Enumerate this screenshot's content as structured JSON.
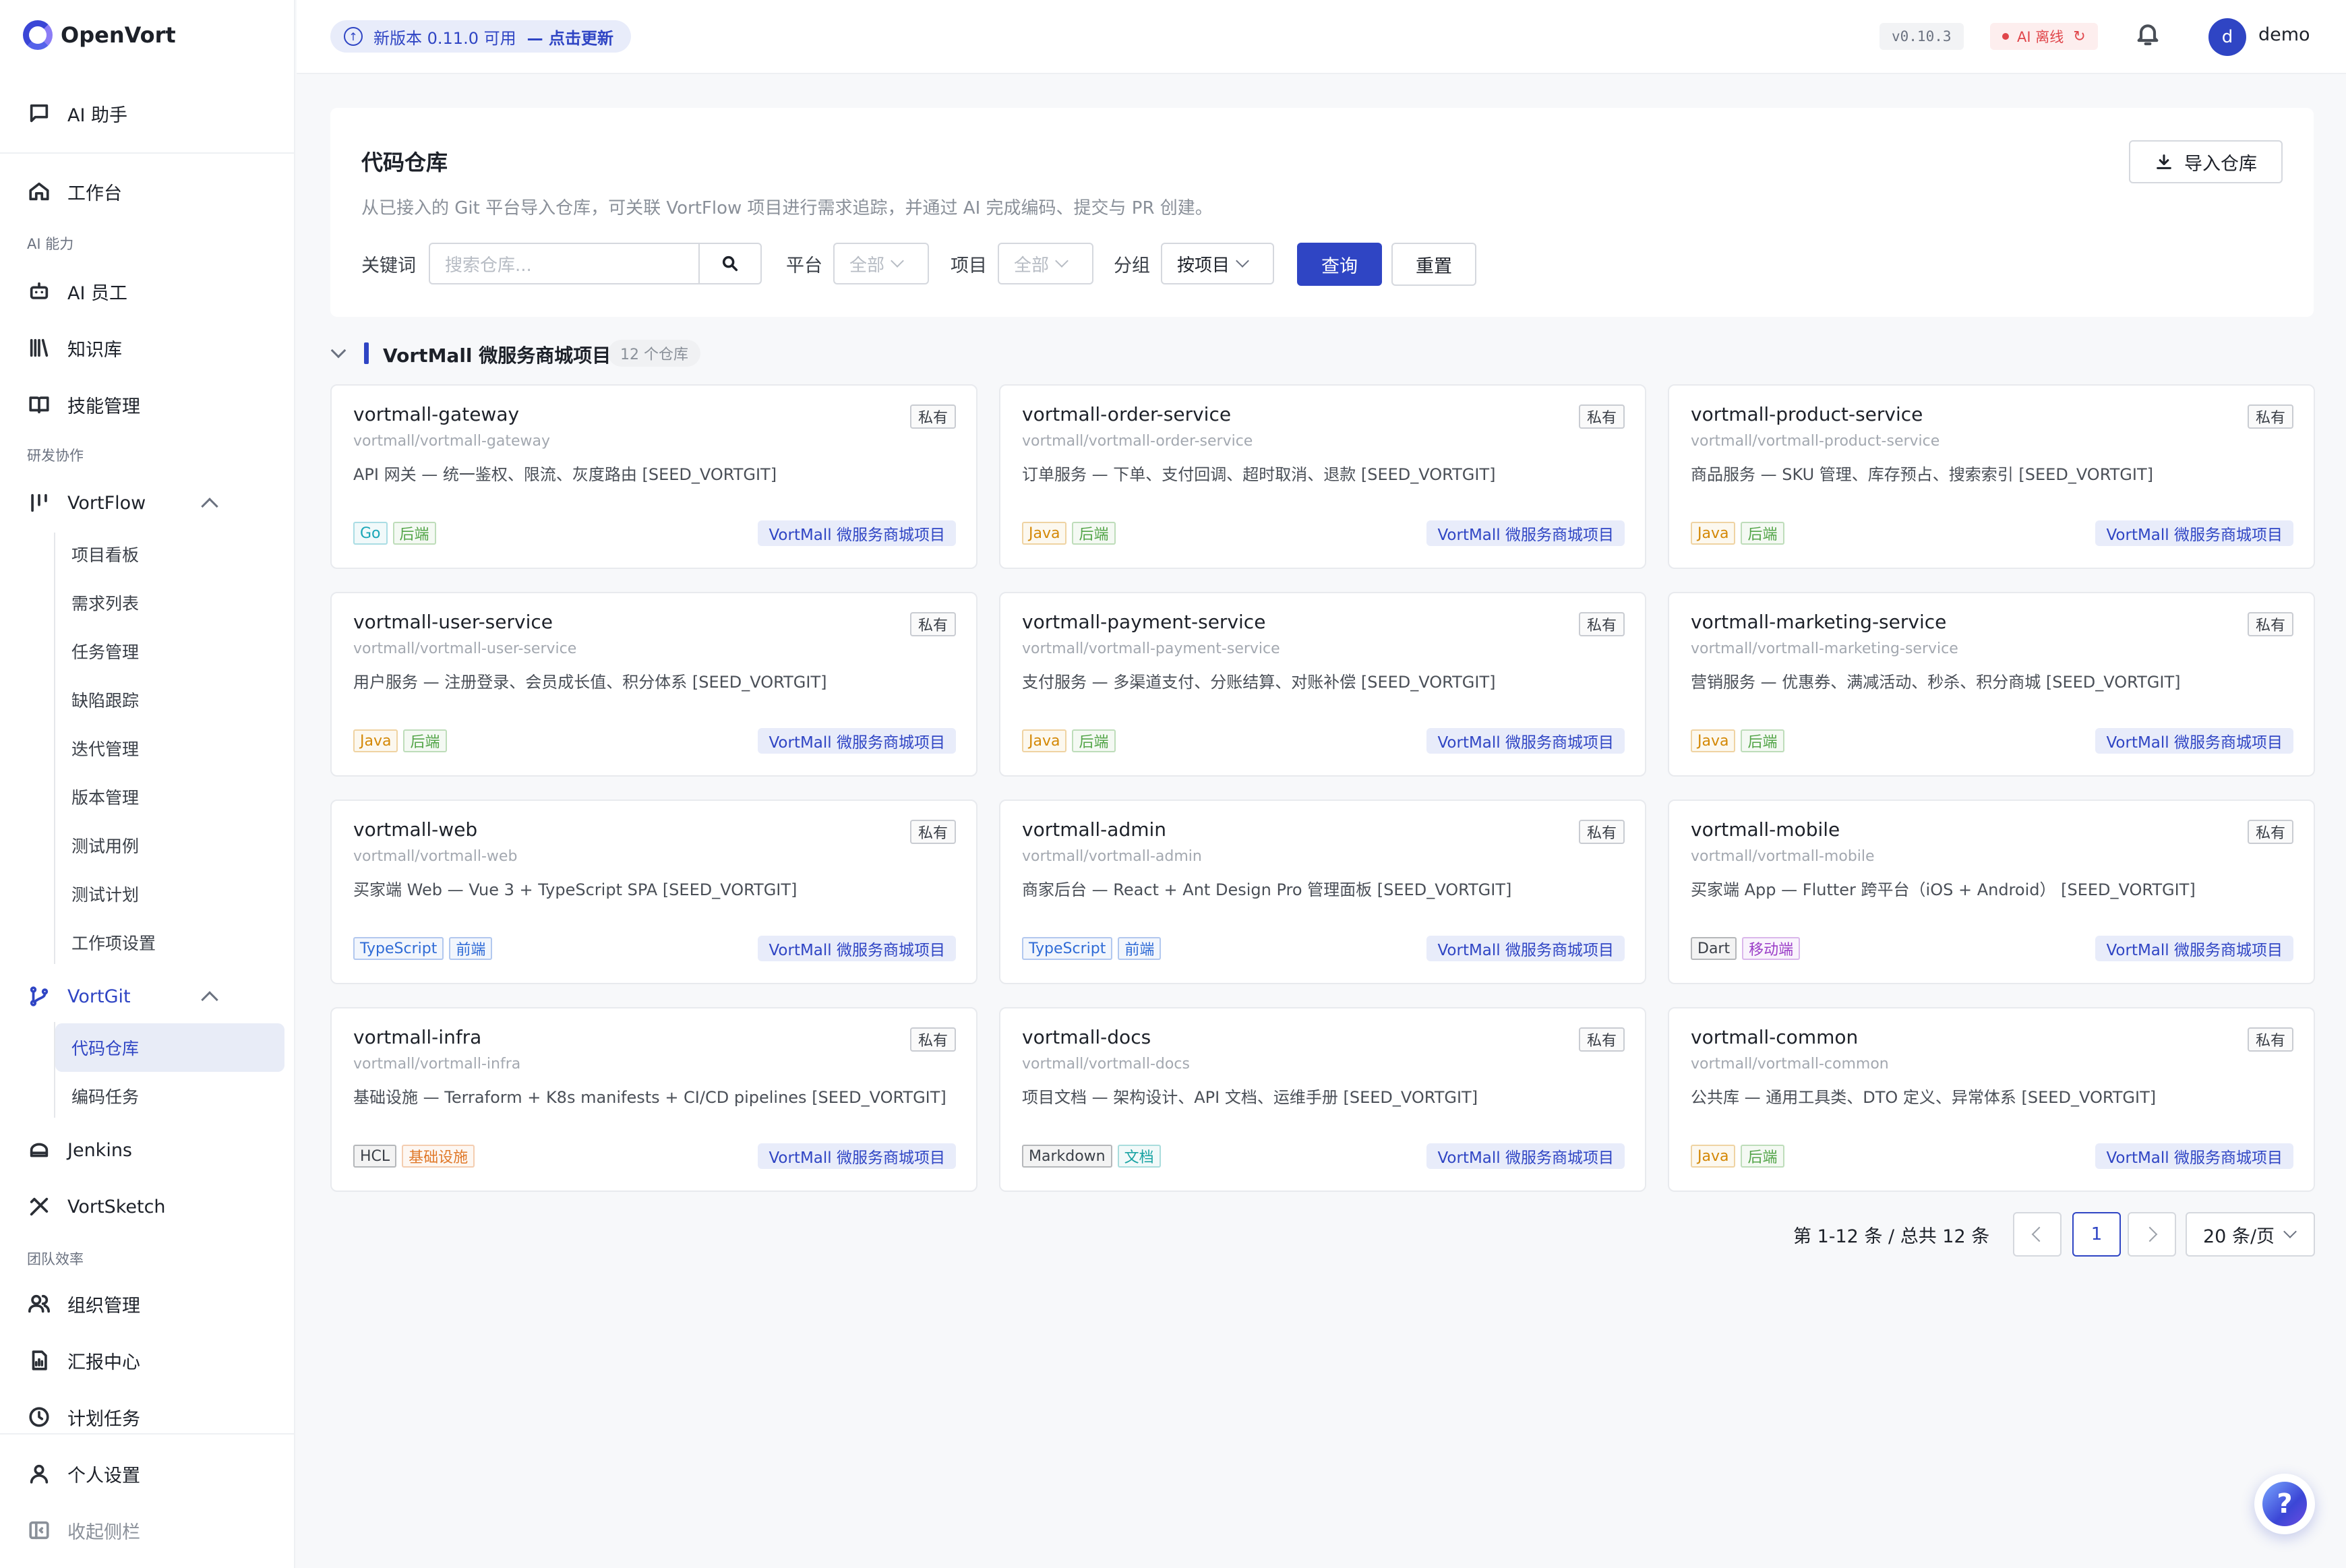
{
  "app": {
    "name": "OpenVort"
  },
  "sidebar": {
    "ai_assistant": "AI 助手",
    "workbench": "工作台",
    "group_ai": "AI 能力",
    "ai_staff": "AI 员工",
    "knowledge": "知识库",
    "skills": "技能管理",
    "group_dev": "研发协作",
    "vortflow": {
      "label": "VortFlow",
      "items": [
        "项目看板",
        "需求列表",
        "任务管理",
        "缺陷跟踪",
        "迭代管理",
        "版本管理",
        "测试用例",
        "测试计划",
        "工作项设置"
      ]
    },
    "vortgit": {
      "label": "VortGit",
      "items": [
        "代码仓库",
        "编码任务"
      ]
    },
    "jenkins": "Jenkins",
    "vortsketch": "VortSketch",
    "group_team": "团队效率",
    "org": "组织管理",
    "reports": "汇报中心",
    "schedules": "计划任务",
    "personal": "个人设置",
    "collapse": "收起侧栏"
  },
  "topbar": {
    "update_text": "新版本 0.11.0 可用",
    "update_link": "— 点击更新",
    "version": "v0.10.3",
    "ai_status": "AI 离线",
    "user_initial": "d",
    "username": "demo"
  },
  "header": {
    "title": "代码仓库",
    "description": "从已接入的 Git 平台导入仓库，可关联 VortFlow 项目进行需求追踪，并通过 AI 完成编码、提交与 PR 创建。",
    "import_button": "导入仓库",
    "filters": {
      "keyword_label": "关键词",
      "keyword_placeholder": "搜索仓库...",
      "platform_label": "平台",
      "platform_value": "全部",
      "project_label": "项目",
      "project_value": "全部",
      "group_label": "分组",
      "group_value": "按项目",
      "query_button": "查询",
      "reset_button": "重置"
    }
  },
  "group": {
    "title": "VortMall 微服务商城项目",
    "count": "12 个仓库"
  },
  "colors": {
    "accent": "#2f45c4",
    "tag_go": "#1aa6b7",
    "tag_java": "#d48806",
    "tag_backend": "#52a447",
    "tag_ts": "#2f6bd6",
    "tag_frontend": "#2f6bd6",
    "tag_mobile": "#9b3ec8",
    "tag_infra": "#e0792a",
    "tag_docs": "#19a3a3",
    "tag_neutral": "#3a3f47"
  },
  "repos": [
    {
      "name": "vortmall-gateway",
      "path": "vortmall/vortmall-gateway",
      "desc": "API 网关 — 统一鉴权、限流、灰度路由 [SEED_VORTGIT]",
      "visibility": "私有",
      "tags": [
        {
          "text": "Go",
          "color": "#1aa6b7"
        },
        {
          "text": "后端",
          "color": "#52a447"
        }
      ],
      "project": "VortMall 微服务商城项目"
    },
    {
      "name": "vortmall-order-service",
      "path": "vortmall/vortmall-order-service",
      "desc": "订单服务 — 下单、支付回调、超时取消、退款 [SEED_VORTGIT]",
      "visibility": "私有",
      "tags": [
        {
          "text": "Java",
          "color": "#d48806"
        },
        {
          "text": "后端",
          "color": "#52a447"
        }
      ],
      "project": "VortMall 微服务商城项目"
    },
    {
      "name": "vortmall-product-service",
      "path": "vortmall/vortmall-product-service",
      "desc": "商品服务 — SKU 管理、库存预占、搜索索引 [SEED_VORTGIT]",
      "visibility": "私有",
      "tags": [
        {
          "text": "Java",
          "color": "#d48806"
        },
        {
          "text": "后端",
          "color": "#52a447"
        }
      ],
      "project": "VortMall 微服务商城项目"
    },
    {
      "name": "vortmall-user-service",
      "path": "vortmall/vortmall-user-service",
      "desc": "用户服务 — 注册登录、会员成长值、积分体系 [SEED_VORTGIT]",
      "visibility": "私有",
      "tags": [
        {
          "text": "Java",
          "color": "#d48806"
        },
        {
          "text": "后端",
          "color": "#52a447"
        }
      ],
      "project": "VortMall 微服务商城项目"
    },
    {
      "name": "vortmall-payment-service",
      "path": "vortmall/vortmall-payment-service",
      "desc": "支付服务 — 多渠道支付、分账结算、对账补偿 [SEED_VORTGIT]",
      "visibility": "私有",
      "tags": [
        {
          "text": "Java",
          "color": "#d48806"
        },
        {
          "text": "后端",
          "color": "#52a447"
        }
      ],
      "project": "VortMall 微服务商城项目"
    },
    {
      "name": "vortmall-marketing-service",
      "path": "vortmall/vortmall-marketing-service",
      "desc": "营销服务 — 优惠券、满减活动、秒杀、积分商城 [SEED_VORTGIT]",
      "visibility": "私有",
      "tags": [
        {
          "text": "Java",
          "color": "#d48806"
        },
        {
          "text": "后端",
          "color": "#52a447"
        }
      ],
      "project": "VortMall 微服务商城项目"
    },
    {
      "name": "vortmall-web",
      "path": "vortmall/vortmall-web",
      "desc": "买家端 Web — Vue 3 + TypeScript SPA [SEED_VORTGIT]",
      "visibility": "私有",
      "tags": [
        {
          "text": "TypeScript",
          "color": "#2f6bd6"
        },
        {
          "text": "前端",
          "color": "#2f6bd6"
        }
      ],
      "project": "VortMall 微服务商城项目"
    },
    {
      "name": "vortmall-admin",
      "path": "vortmall/vortmall-admin",
      "desc": "商家后台 — React + Ant Design Pro 管理面板 [SEED_VORTGIT]",
      "visibility": "私有",
      "tags": [
        {
          "text": "TypeScript",
          "color": "#2f6bd6"
        },
        {
          "text": "前端",
          "color": "#2f6bd6"
        }
      ],
      "project": "VortMall 微服务商城项目"
    },
    {
      "name": "vortmall-mobile",
      "path": "vortmall/vortmall-mobile",
      "desc": "买家端 App — Flutter 跨平台（iOS + Android） [SEED_VORTGIT]",
      "visibility": "私有",
      "tags": [
        {
          "text": "Dart",
          "color": "#3a3f47"
        },
        {
          "text": "移动端",
          "color": "#9b3ec8"
        }
      ],
      "project": "VortMall 微服务商城项目"
    },
    {
      "name": "vortmall-infra",
      "path": "vortmall/vortmall-infra",
      "desc": "基础设施 — Terraform + K8s manifests + CI/CD pipelines [SEED_VORTGIT]",
      "visibility": "私有",
      "tags": [
        {
          "text": "HCL",
          "color": "#3a3f47"
        },
        {
          "text": "基础设施",
          "color": "#e0792a"
        }
      ],
      "project": "VortMall 微服务商城项目"
    },
    {
      "name": "vortmall-docs",
      "path": "vortmall/vortmall-docs",
      "desc": "项目文档 — 架构设计、API 文档、运维手册 [SEED_VORTGIT]",
      "visibility": "私有",
      "tags": [
        {
          "text": "Markdown",
          "color": "#3a3f47"
        },
        {
          "text": "文档",
          "color": "#19a3a3"
        }
      ],
      "project": "VortMall 微服务商城项目"
    },
    {
      "name": "vortmall-common",
      "path": "vortmall/vortmall-common",
      "desc": "公共库 — 通用工具类、DTO 定义、异常体系 [SEED_VORTGIT]",
      "visibility": "私有",
      "tags": [
        {
          "text": "Java",
          "color": "#d48806"
        },
        {
          "text": "后端",
          "color": "#52a447"
        }
      ],
      "project": "VortMall 微服务商城项目"
    }
  ],
  "pagination": {
    "info": "第 1-12 条 / 总共 12 条",
    "current_page": "1",
    "page_size": "20 条/页"
  }
}
